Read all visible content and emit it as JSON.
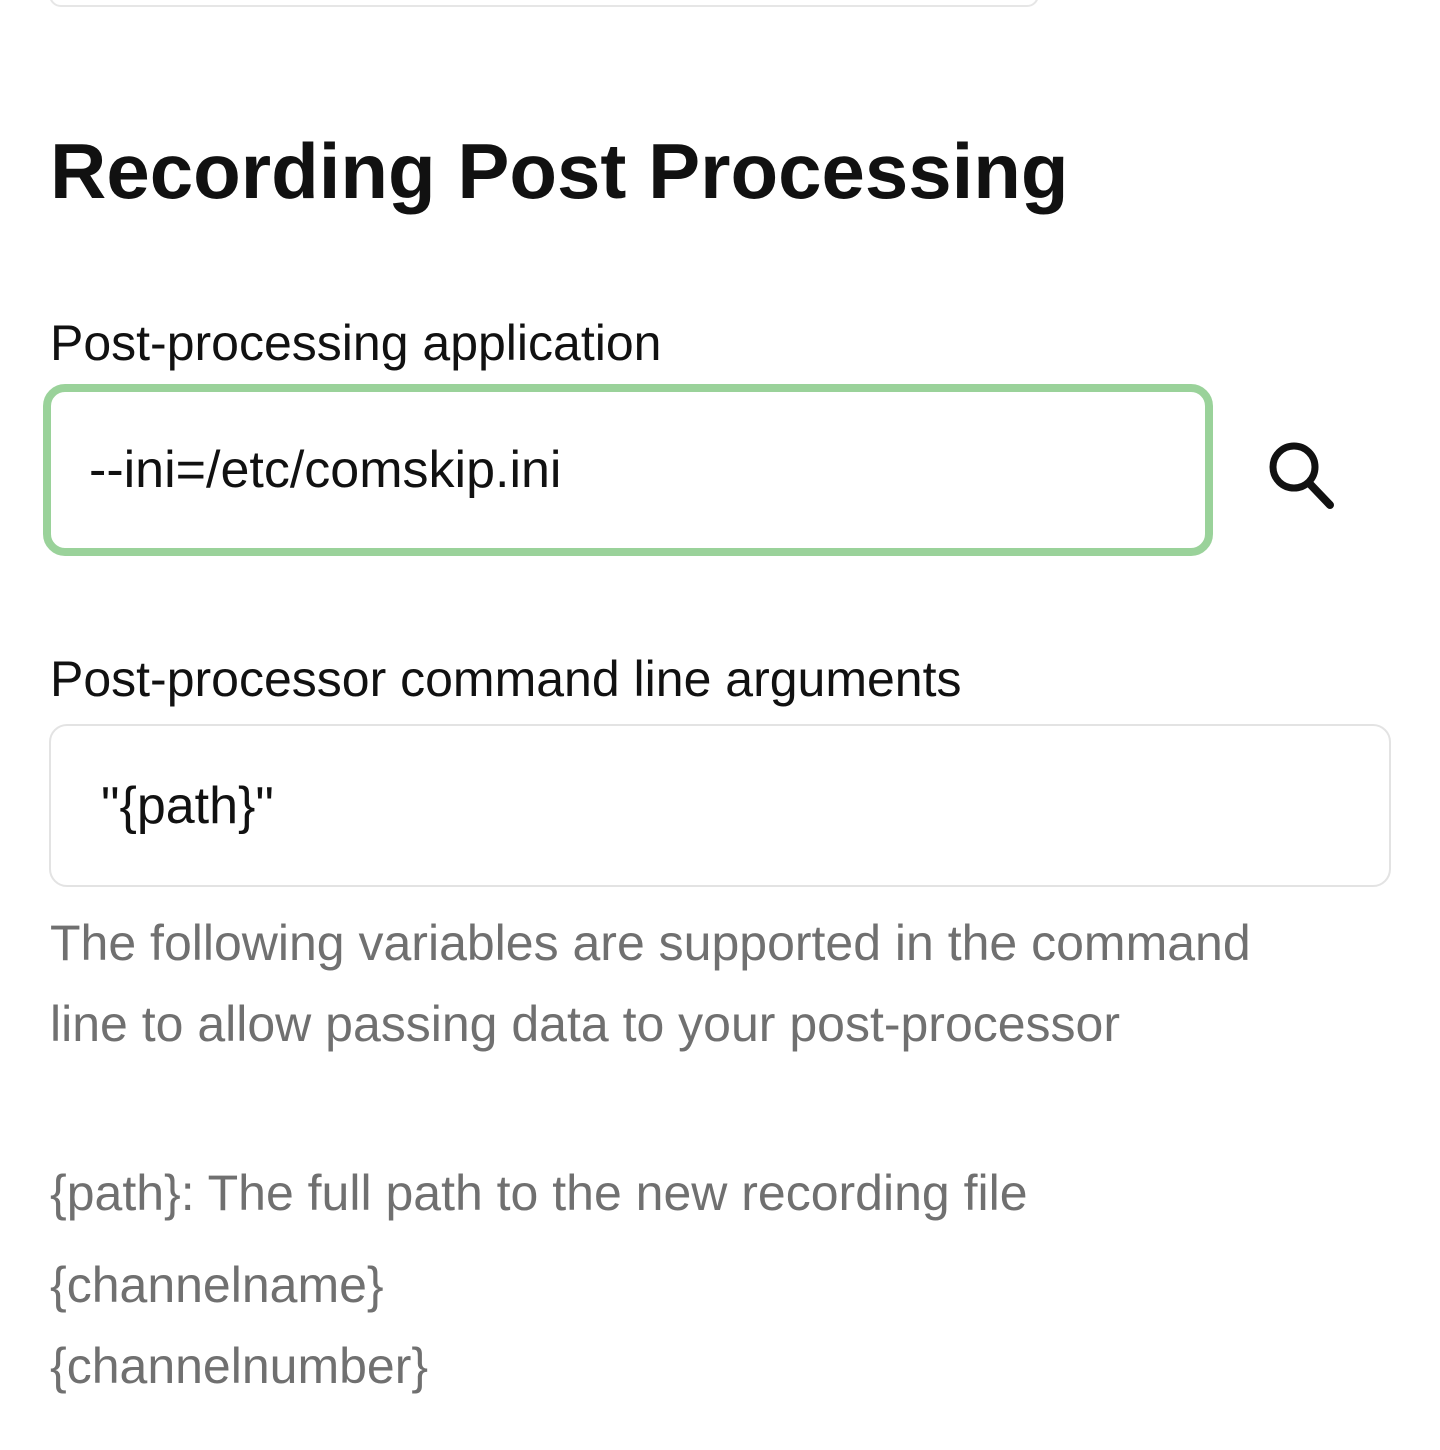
{
  "section": {
    "title": "Recording Post Processing"
  },
  "post_processing_application": {
    "label": "Post-processing application",
    "value": "--ini=/etc/comskip.ini",
    "browse_icon": "search-icon",
    "focus_color": "#9ad29a"
  },
  "command_line_arguments": {
    "label": "Post-processor command line arguments",
    "value": "\"{path}\""
  },
  "help": {
    "description": "The following variables are supported in the command line to allow passing data to your post-processor",
    "variables": [
      "{path}: The full path to the new recording file",
      "{channelname}",
      "{channelnumber}"
    ]
  }
}
